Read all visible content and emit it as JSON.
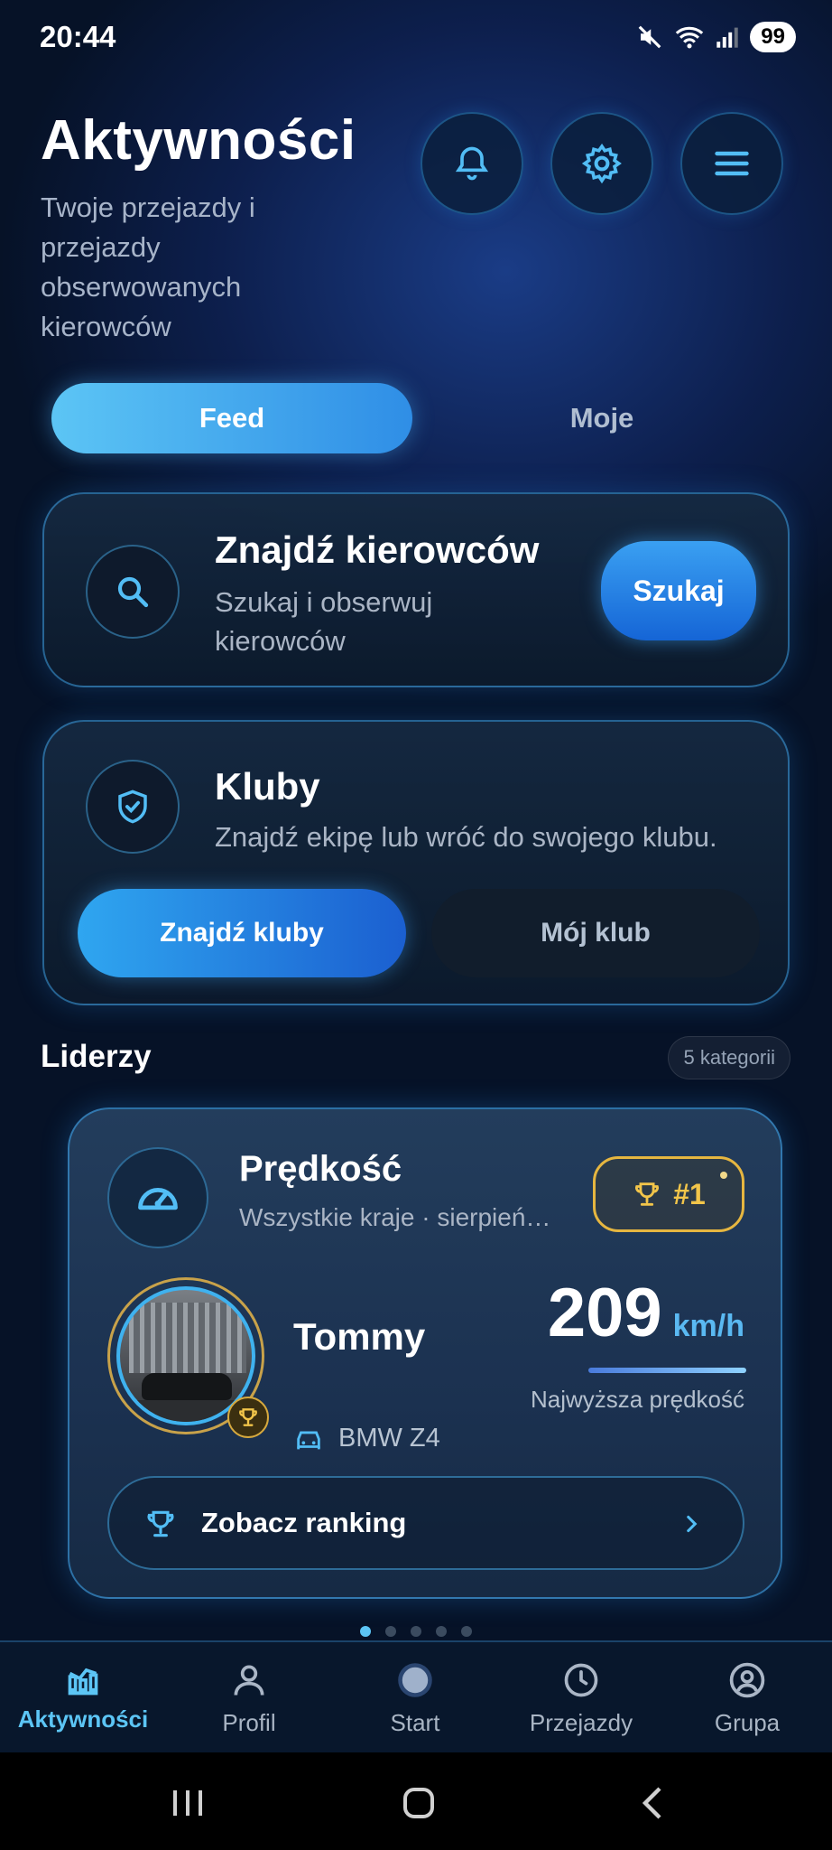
{
  "status_bar": {
    "time": "20:44",
    "battery": "99"
  },
  "header": {
    "title": "Aktywności",
    "subtitle": "Twoje przejazdy i przejazdy obserwowanych kierowców"
  },
  "tabs": [
    {
      "label": "Feed",
      "selected": true
    },
    {
      "label": "Moje",
      "selected": false
    }
  ],
  "find_drivers": {
    "title": "Znajdź kierowców",
    "subtitle": "Szukaj i obserwuj kierowców",
    "button": "Szukaj"
  },
  "clubs": {
    "title": "Kluby",
    "subtitle": "Znajdź ekipę lub wróć do swojego klubu.",
    "find_button": "Znajdź kluby",
    "my_club_button": "Mój klub"
  },
  "leaders": {
    "title": "Liderzy",
    "badge": "5 kategorii",
    "card": {
      "category": "Prędkość",
      "filter": "Wszystkie kraje · sierpień…",
      "rank": "#1",
      "driver_name": "Tommy",
      "car": "BMW Z4",
      "value": "209",
      "unit": "km/h",
      "caption": "Najwyższa prędkość",
      "link": "Zobacz ranking"
    },
    "pager": {
      "pages": 5,
      "current": 1
    }
  },
  "bottom_nav": [
    {
      "label": "Aktywności",
      "icon": "chart-icon",
      "active": true
    },
    {
      "label": "Profil",
      "icon": "person-icon",
      "active": false
    },
    {
      "label": "Start",
      "icon": "start-dot-icon",
      "active": false
    },
    {
      "label": "Przejazdy",
      "icon": "clock-icon",
      "active": false
    },
    {
      "label": "Grupa",
      "icon": "group-icon",
      "active": false
    }
  ],
  "colors": {
    "accent": "#5cc5f5",
    "gold": "#e6b640",
    "background": "#061227"
  }
}
